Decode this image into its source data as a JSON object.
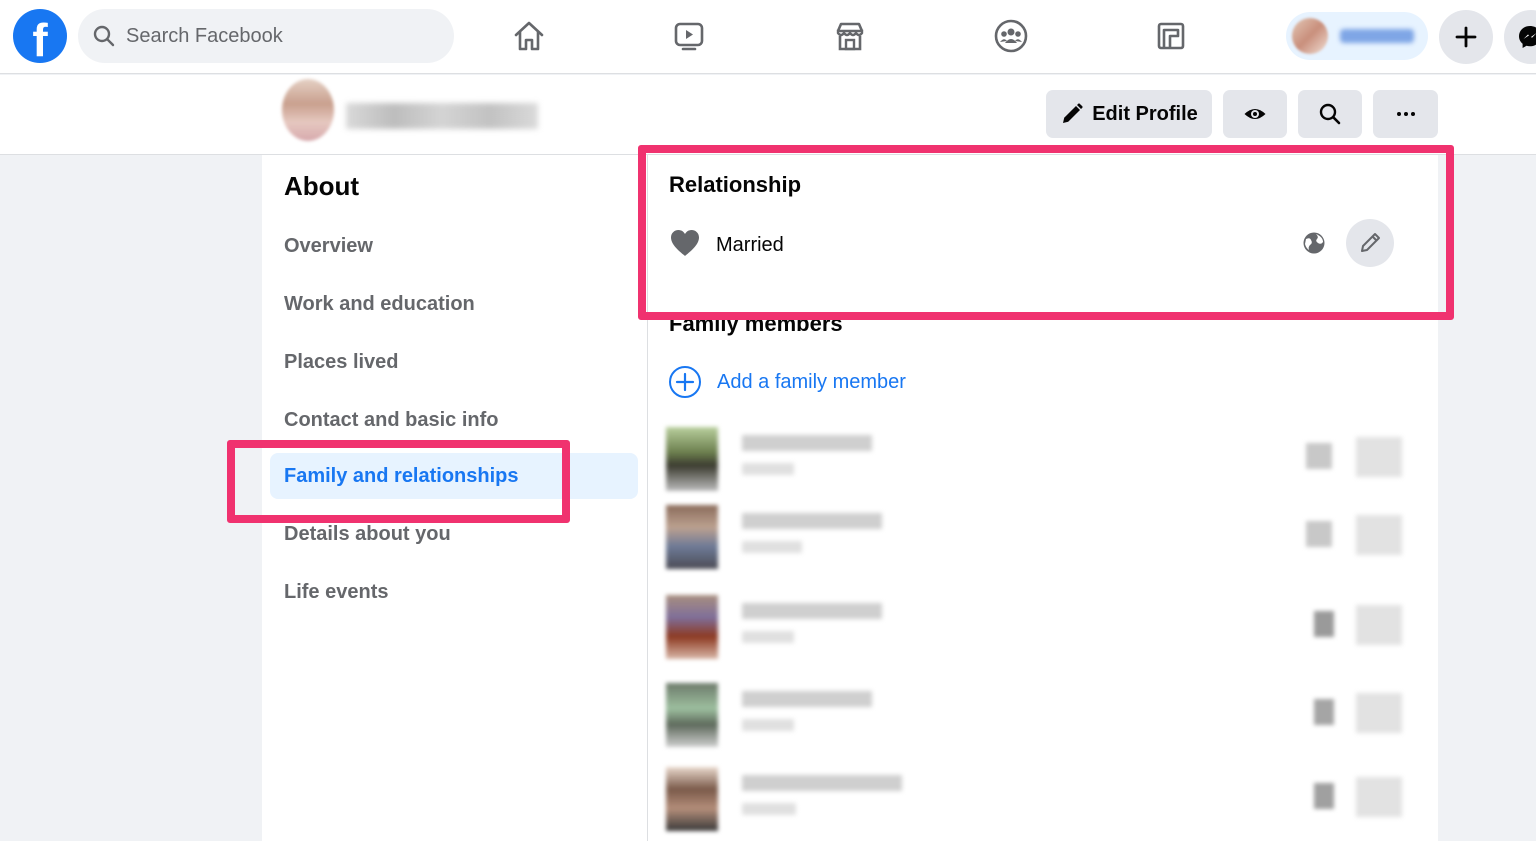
{
  "topbar": {
    "logo_letter": "f",
    "search_placeholder": "Search Facebook",
    "nav_icons": [
      "home-icon",
      "watch-icon",
      "marketplace-icon",
      "groups-icon",
      "gaming-icon"
    ],
    "create_icon": "plus-icon",
    "messenger_icon": "messenger-icon"
  },
  "profile_header": {
    "edit_profile_label": "Edit Profile",
    "view_as_icon": "eye-icon",
    "search_icon": "search-icon",
    "more_icon": "more-icon"
  },
  "about": {
    "title": "About",
    "items": [
      {
        "label": "Overview",
        "active": false
      },
      {
        "label": "Work and education",
        "active": false
      },
      {
        "label": "Places lived",
        "active": false
      },
      {
        "label": "Contact and basic info",
        "active": false
      },
      {
        "label": "Family and relationships",
        "active": true
      },
      {
        "label": "Details about you",
        "active": false
      },
      {
        "label": "Life events",
        "active": false
      }
    ]
  },
  "relationship": {
    "title": "Relationship",
    "status": "Married",
    "privacy_icon": "globe-icon",
    "edit_icon": "pencil-icon"
  },
  "family": {
    "title": "Family members",
    "add_label": "Add a family member"
  },
  "colors": {
    "brand": "#1877f2",
    "highlight": "#f0326f",
    "active_bg": "#e7f3ff"
  }
}
